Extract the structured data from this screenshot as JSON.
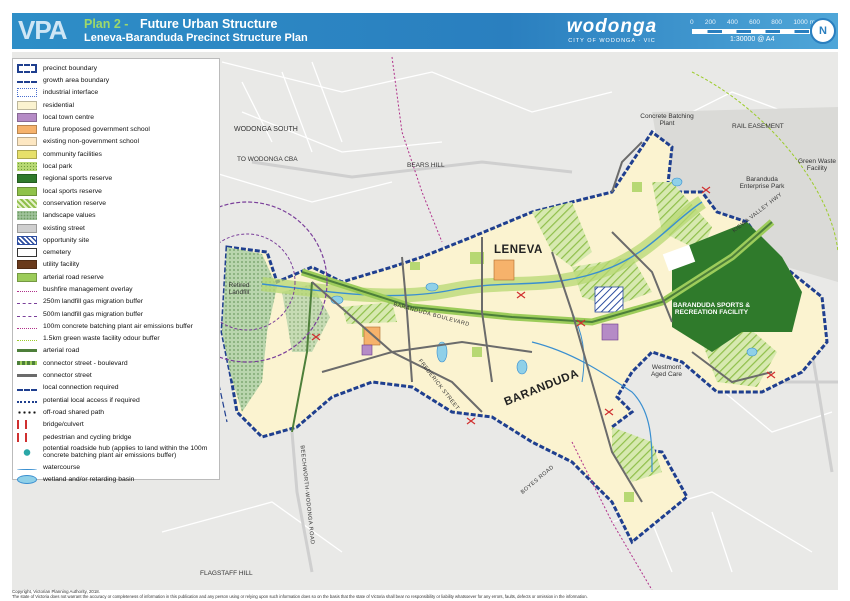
{
  "header": {
    "org_logo": "VPA",
    "plan_label": "Plan 2 -",
    "title": "Future Urban Structure",
    "subtitle": "Leneva-Baranduda Precinct Structure Plan",
    "council_logo": "wodonga",
    "council_sub": "CITY OF WODONGA · VIC",
    "scale_ticks": [
      "0",
      "200",
      "400",
      "600",
      "800",
      "1000 m"
    ],
    "scale_ratio": "1:30000 @ A4",
    "north": "N",
    "header_color": "#2a7fbf"
  },
  "legend": {
    "items": [
      {
        "label": "precinct boundary",
        "icon": "precinct-boundary",
        "color": "#1f3f8f"
      },
      {
        "label": "growth area boundary",
        "icon": "growth-area-boundary",
        "color": "#1f3f8f"
      },
      {
        "label": "industrial interface",
        "icon": "industrial-interface",
        "color": "#4a6fd0"
      },
      {
        "label": "residential",
        "icon": "residential",
        "color": "#fbf3d0"
      },
      {
        "label": "local town centre",
        "icon": "local-town-centre",
        "color": "#b58bc6"
      },
      {
        "label": "future proposed government school",
        "icon": "gov-school",
        "color": "#f6b26b"
      },
      {
        "label": "existing non-government school",
        "icon": "nongov-school",
        "color": "#fde7c2"
      },
      {
        "label": "community facilities",
        "icon": "community-facilities",
        "color": "#e7e06a"
      },
      {
        "label": "local park",
        "icon": "local-park",
        "color": "#b7d873"
      },
      {
        "label": "regional sports reserve",
        "icon": "regional-sports",
        "color": "#2f7a2b"
      },
      {
        "label": "local sports reserve",
        "icon": "local-sports",
        "color": "#8fc24a"
      },
      {
        "label": "conservation reserve",
        "icon": "conservation",
        "color": "#a9cf6b"
      },
      {
        "label": "landscape values",
        "icon": "landscape",
        "color": "#9fc29a"
      },
      {
        "label": "existing street",
        "icon": "existing-street",
        "color": "#cfcfcf"
      },
      {
        "label": "opportunity site",
        "icon": "opportunity-site",
        "color": "#2e4ea0"
      },
      {
        "label": "cemetery",
        "icon": "cemetery",
        "color": "#ffffff"
      },
      {
        "label": "utility facility",
        "icon": "utility",
        "color": "#6a3a1b"
      },
      {
        "label": "arterial road reserve",
        "icon": "arterial-reserve",
        "color": "#9ccc5a"
      },
      {
        "label": "bushfire management overlay",
        "icon": "bushfire",
        "color": "#b0308a"
      },
      {
        "label": "250m landfill gas migration buffer",
        "icon": "buffer-250",
        "color": "#7a3f9a"
      },
      {
        "label": "500m landfill gas migration buffer",
        "icon": "buffer-500",
        "color": "#7a3f9a"
      },
      {
        "label": "100m concrete batching plant air emissions buffer",
        "icon": "buffer-100",
        "color": "#b0308a"
      },
      {
        "label": "1.5km green waste facility odour buffer",
        "icon": "buffer-odour",
        "color": "#9ccc2a"
      },
      {
        "label": "arterial road",
        "icon": "arterial-road",
        "color": "#4d7f3a"
      },
      {
        "label": "connector street - boulevard",
        "icon": "boulevard",
        "color": "#4d7f3a"
      },
      {
        "label": "connector street",
        "icon": "connector",
        "color": "#6b6b6b"
      },
      {
        "label": "local connection required",
        "icon": "local-connection",
        "color": "#1f3f8f"
      },
      {
        "label": "potential local access if required",
        "icon": "potential-access",
        "color": "#1f3f8f"
      },
      {
        "label": "off-road shared path",
        "icon": "shared-path",
        "color": "#111111"
      },
      {
        "label": "bridge/culvert",
        "icon": "bridge",
        "color": "#d03030"
      },
      {
        "label": "pedestrian and cycling bridge",
        "icon": "ped-bridge",
        "color": "#d03030"
      },
      {
        "label": "potential roadside hub (applies to land within the 100m concrete batching plant air emissions buffer)",
        "icon": "roadside-hub",
        "color": "#2aa7a7"
      },
      {
        "label": "watercourse",
        "icon": "watercourse",
        "color": "#3a8fd0"
      },
      {
        "label": "wetland and/or retarding basin",
        "icon": "wetland",
        "color": "#8fd0e8"
      }
    ]
  },
  "map": {
    "places": {
      "wodonga_south": "WODONGA SOUTH",
      "to_wodonga_cba": "TO WODONGA CBA",
      "bears_hill": "BEARS HILL",
      "concrete_plant": "Concrete Batching Plant",
      "rail_easement": "RAIL EASEMENT",
      "green_waste": "Green Waste Facility",
      "baranduda_park": "Baranduda Enterprise Park",
      "leneva": "LENEVA",
      "baranduda": "BARANDUDA",
      "retired_landfill": "Retired Landfill",
      "westmont": "Westmont Aged Care",
      "sports_facility": "BARANDUDA SPORTS & RECREATION FACILITY",
      "flagstaff": "FLAGSTAFF HILL"
    },
    "roads": {
      "kiewa": "KIEWA VALLEY HWY",
      "boulevard": "BARANDUDA BOULEVARD",
      "frederick": "FREDERICK STREET",
      "beechworth": "BEECHWORTH-WODONGA ROAD",
      "boyes": "BOYES ROAD"
    }
  },
  "footer": {
    "copyright": "Copyright, Victorian Planning Authority, 2018.",
    "disclaimer": "The state of Victoria does not warrant the accuracy or completeness of information in this publication and any person using or relying upon such information does so on the basis that the state of Victoria shall bear no responsibility or liability whatsoever for any errors, faults, defects or omission in the information."
  }
}
